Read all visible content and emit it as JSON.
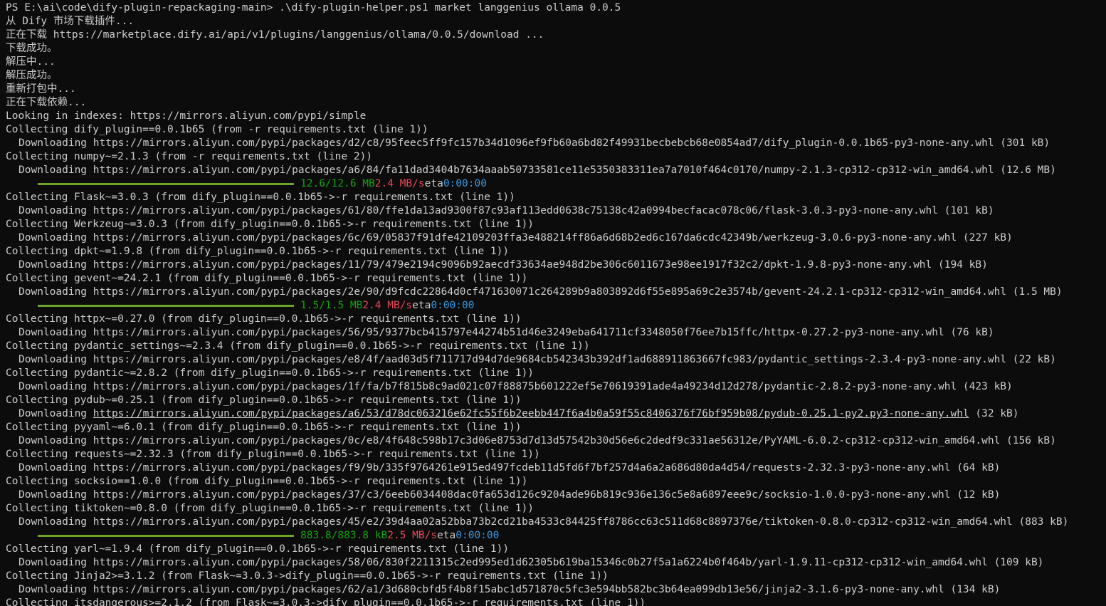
{
  "terminal": {
    "prompt": "PS E:\\ai\\code\\dify-plugin-repackaging-main> ",
    "command": ".\\dify-plugin-helper.ps1 market langgenius ollama 0.0.5",
    "lines": [
      "从 Dify 市场下载插件...",
      "正在下载 https://marketplace.dify.ai/api/v1/plugins/langgenius/ollama/0.0.5/download ...",
      "下载成功。",
      "解压中...",
      "解压成功。",
      "重新打包中...",
      "正在下载依赖...",
      "Looking in indexes: https://mirrors.aliyun.com/pypi/simple",
      "Collecting dify_plugin==0.0.1b65 (from -r requirements.txt (line 1))",
      "Downloading https://mirrors.aliyun.com/pypi/packages/d2/c8/95feec5ff9fc157b34d1096ef9fb60a6bd82f49931becbebcb68e0854ad7/dify_plugin-0.0.1b65-py3-none-any.whl (301 kB)",
      "Collecting numpy~=2.1.3 (from -r requirements.txt (line 2))",
      "Downloading https://mirrors.aliyun.com/pypi/packages/a6/84/fa11dad3404b7634aaab50733581ce11e5350383311ea7a7010f464c0170/numpy-2.1.3-cp312-cp312-win_amd64.whl (12.6 MB)",
      "",
      "Collecting Flask~=3.0.3 (from dify_plugin==0.0.1b65->-r requirements.txt (line 1))",
      "Downloading https://mirrors.aliyun.com/pypi/packages/61/80/ffe1da13ad9300f87c93af113edd0638c75138c42a0994becfacac078c06/flask-3.0.3-py3-none-any.whl (101 kB)",
      "Collecting Werkzeug~=3.0.3 (from dify_plugin==0.0.1b65->-r requirements.txt (line 1))",
      "Downloading https://mirrors.aliyun.com/pypi/packages/6c/69/05837f91dfe42109203ffa3e488214ff86a6d68b2ed6c167da6cdc42349b/werkzeug-3.0.6-py3-none-any.whl (227 kB)",
      "Collecting dpkt~=1.9.8 (from dify_plugin==0.0.1b65->-r requirements.txt (line 1))",
      "Downloading https://mirrors.aliyun.com/pypi/packages/11/79/479e2194c9096b92aecdf33634ae948d2be306c6011673e98ee1917f32c2/dpkt-1.9.8-py3-none-any.whl (194 kB)",
      "Collecting gevent~=24.2.1 (from dify_plugin==0.0.1b65->-r requirements.txt (line 1))",
      "Downloading https://mirrors.aliyun.com/pypi/packages/2e/90/d9fcdc22864d0cf471630071c264289b9a803892d6f55e895a69c2e3574b/gevent-24.2.1-cp312-cp312-win_amd64.whl (1.5 MB)",
      "",
      "Collecting httpx~=0.27.0 (from dify_plugin==0.0.1b65->-r requirements.txt (line 1))",
      "Downloading https://mirrors.aliyun.com/pypi/packages/56/95/9377bcb415797e44274b51d46e3249eba641711cf3348050f76ee7b15ffc/httpx-0.27.2-py3-none-any.whl (76 kB)",
      "Collecting pydantic_settings~=2.3.4 (from dify_plugin==0.0.1b65->-r requirements.txt (line 1))",
      "Downloading https://mirrors.aliyun.com/pypi/packages/e8/4f/aad03d5f711717d94d7de9684cb542343b392df1ad688911863667fc983/pydantic_settings-2.3.4-py3-none-any.whl (22 kB)",
      "Collecting pydantic~=2.8.2 (from dify_plugin==0.0.1b65->-r requirements.txt (line 1))",
      "Downloading https://mirrors.aliyun.com/pypi/packages/1f/fa/b7f815b8c9ad021c07f88875b601222ef5e70619391ade4a49234d12d278/pydantic-2.8.2-py3-none-any.whl (423 kB)",
      "Collecting pydub~=0.25.1 (from dify_plugin==0.0.1b65->-r requirements.txt (line 1))",
      "",
      "Collecting pyyaml~=6.0.1 (from dify_plugin==0.0.1b65->-r requirements.txt (line 1))",
      "Downloading https://mirrors.aliyun.com/pypi/packages/0c/e8/4f648c598b17c3d06e8753d7d13d57542b30d56e6c2dedf9c331ae56312e/PyYAML-6.0.2-cp312-cp312-win_amd64.whl (156 kB)",
      "Collecting requests~=2.32.3 (from dify_plugin==0.0.1b65->-r requirements.txt (line 1))",
      "Downloading https://mirrors.aliyun.com/pypi/packages/f9/9b/335f9764261e915ed497fcdeb11d5fd6f7bf257d4a6a2a686d80da4d54/requests-2.32.3-py3-none-any.whl (64 kB)",
      "Collecting socksio==1.0.0 (from dify_plugin==0.0.1b65->-r requirements.txt (line 1))",
      "Downloading https://mirrors.aliyun.com/pypi/packages/37/c3/6eeb6034408dac0fa653d126c9204ade96b819c936e136c5e8a6897eee9c/socksio-1.0.0-py3-none-any.whl (12 kB)",
      "Collecting tiktoken~=0.8.0 (from dify_plugin==0.0.1b65->-r requirements.txt (line 1))",
      "Downloading https://mirrors.aliyun.com/pypi/packages/45/e2/39d4aa02a52bba73b2cd21ba4533c84425ff8786cc63c511d68c8897376e/tiktoken-0.8.0-cp312-cp312-win_amd64.whl (883 kB)",
      "",
      "Collecting yarl~=1.9.4 (from dify_plugin==0.0.1b65->-r requirements.txt (line 1))",
      "Downloading https://mirrors.aliyun.com/pypi/packages/58/06/830f2211315c2ed995ed1d62305b619ba15346c0b27f5a1a6224b0f464b/yarl-1.9.11-cp312-cp312-win_amd64.whl (109 kB)",
      "Collecting Jinja2>=3.1.2 (from Flask~=3.0.3->dify_plugin==0.0.1b65->-r requirements.txt (line 1))",
      "Downloading https://mirrors.aliyun.com/pypi/packages/62/a1/3d680cbfd5f4b8f15abc1d571870c5fc3e594bb582bc3b64ea099db13e56/jinja2-3.1.6-py3-none-any.whl (134 kB)",
      "Collecting itsdangerous>=2.1.2 (from Flask~=3.0.3->dify_plugin==0.0.1b65->-r requirements.txt (line 1))"
    ],
    "pydub_download": {
      "prefix": "Downloading ",
      "url": "https://mirrors.aliyun.com/pypi/packages/a6/53/d78dc063216e62fc55f6b2eebb447f6a4b0a59f55c8406376f76bf959b08/pydub-0.25.1-py2.py3-none-any.whl",
      "suffix": " (32 kB)"
    },
    "progress": [
      {
        "amount": "12.6/12.6 MB",
        "speed": "2.4 MB/s",
        "eta_label": "eta",
        "eta": "0:00:00",
        "fraction": 1.0
      },
      {
        "amount": "1.5/1.5 MB",
        "speed": "2.4 MB/s",
        "eta_label": "eta",
        "eta": "0:00:00",
        "fraction": 1.0
      },
      {
        "amount": "883.8/883.8 kB",
        "speed": "2.5 MB/s",
        "eta_label": "eta",
        "eta": "0:00:00",
        "fraction": 1.0
      }
    ],
    "colors": {
      "background": "#0c0c0c",
      "text": "#cccccc",
      "progress_bar": "#6ca32a",
      "amount": "#13a10e",
      "speed": "#e74856",
      "eta": "#3a96dd"
    }
  }
}
